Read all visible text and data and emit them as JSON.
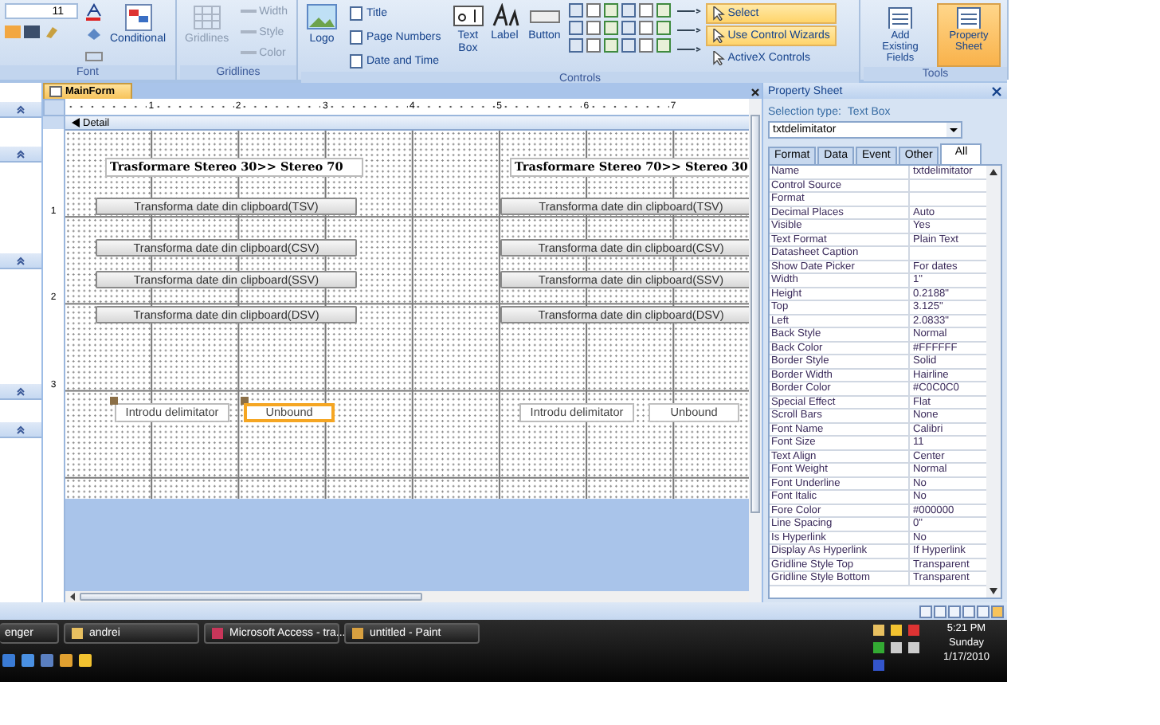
{
  "ribbon": {
    "font_group": {
      "label": "Font",
      "font_size": "11",
      "conditional": "Conditional"
    },
    "gridlines_group": {
      "label": "Gridlines",
      "disabled": true,
      "gridlines": "Gridlines",
      "items": [
        "Width",
        "Style",
        "Color"
      ]
    },
    "controls_group": {
      "label": "Controls",
      "logo": "Logo",
      "header_items": [
        "Title",
        "Page Numbers",
        "Date and Time"
      ],
      "tools": [
        "Text Box",
        "Label",
        "Button"
      ],
      "options": [
        {
          "label": "Select",
          "on": true
        },
        {
          "label": "Use Control Wizards",
          "on": true
        },
        {
          "label": "ActiveX Controls",
          "on": false
        }
      ]
    },
    "tools_group": {
      "label": "Tools",
      "buttons": [
        {
          "label": "Add Existing Fields",
          "selected": false
        },
        {
          "label": "Property Sheet",
          "selected": true
        }
      ]
    }
  },
  "form": {
    "tab": "MainForm",
    "ruler": [
      "1",
      "2",
      "3",
      "4",
      "5",
      "6",
      "7"
    ],
    "vertical_ruler": [
      "1",
      "2",
      "3"
    ],
    "section": "Detail",
    "columns": [
      {
        "title": "Trasformare Stereo 30>> Stereo 70",
        "buttons": [
          "Transforma date din clipboard(TSV)",
          "Transforma date din clipboard(CSV)",
          "Transforma date din clipboard(SSV)",
          "Transforma date din clipboard(DSV)"
        ],
        "label": "Introdu delimitator",
        "textbox": {
          "value": "Unbound",
          "selected": true
        }
      },
      {
        "title": "Trasformare Stereo 70>> Stereo 30",
        "buttons": [
          "Transforma date din clipboard(TSV)",
          "Transforma date din clipboard(CSV)",
          "Transforma date din clipboard(SSV)",
          "Transforma date din clipboard(DSV)"
        ],
        "label": "Introdu delimitator",
        "textbox": {
          "value": "Unbound",
          "selected": false
        }
      }
    ]
  },
  "property_sheet": {
    "title": "Property Sheet",
    "selection_type_label": "Selection type:",
    "selection_type": "Text Box",
    "object": "txtdelimitator",
    "tabs": [
      {
        "label": "Format",
        "selected": false
      },
      {
        "label": "Data",
        "selected": false
      },
      {
        "label": "Event",
        "selected": false
      },
      {
        "label": "Other",
        "selected": false
      },
      {
        "label": "All",
        "selected": true
      }
    ],
    "rows": [
      {
        "name": "Name",
        "value": "txtdelimitator"
      },
      {
        "name": "Control Source"
      },
      {
        "name": "Format"
      },
      {
        "name": "Decimal Places",
        "value": "Auto"
      },
      {
        "name": "Visible",
        "value": "Yes"
      },
      {
        "name": "Text Format",
        "value": "Plain Text"
      },
      {
        "name": "Datasheet Caption"
      },
      {
        "name": "Show Date Picker",
        "value": "For dates"
      },
      {
        "name": "Width",
        "value": "1\""
      },
      {
        "name": "Height",
        "value": "0.2188\""
      },
      {
        "name": "Top",
        "value": "3.125\""
      },
      {
        "name": "Left",
        "value": "2.0833\""
      },
      {
        "name": "Back Style",
        "value": "Normal"
      },
      {
        "name": "Back Color",
        "value": "#FFFFFF"
      },
      {
        "name": "Border Style",
        "value": "Solid"
      },
      {
        "name": "Border Width",
        "value": "Hairline"
      },
      {
        "name": "Border Color",
        "value": "#C0C0C0"
      },
      {
        "name": "Special Effect",
        "value": "Flat"
      },
      {
        "name": "Scroll Bars",
        "value": "None"
      },
      {
        "name": "Font Name",
        "value": "Calibri"
      },
      {
        "name": "Font Size",
        "value": "11"
      },
      {
        "name": "Text Align",
        "value": "Center"
      },
      {
        "name": "Font Weight",
        "value": "Normal"
      },
      {
        "name": "Font Underline",
        "value": "No"
      },
      {
        "name": "Font Italic",
        "value": "No"
      },
      {
        "name": "Fore Color",
        "value": "#000000"
      },
      {
        "name": "Line Spacing",
        "value": "0\""
      },
      {
        "name": "Is Hyperlink",
        "value": "No"
      },
      {
        "name": "Display As Hyperlink",
        "value": "If Hyperlink"
      },
      {
        "name": "Gridline Style Top",
        "value": "Transparent"
      },
      {
        "name": "Gridline Style Bottom",
        "value": "Transparent"
      }
    ]
  },
  "taskbar": {
    "buttons": [
      "enger",
      "andrei",
      "Microsoft Access - tra...",
      "untitled - Paint"
    ],
    "clock": {
      "time": "5:21 PM",
      "day": "Sunday",
      "date": "1/17/2010"
    }
  }
}
